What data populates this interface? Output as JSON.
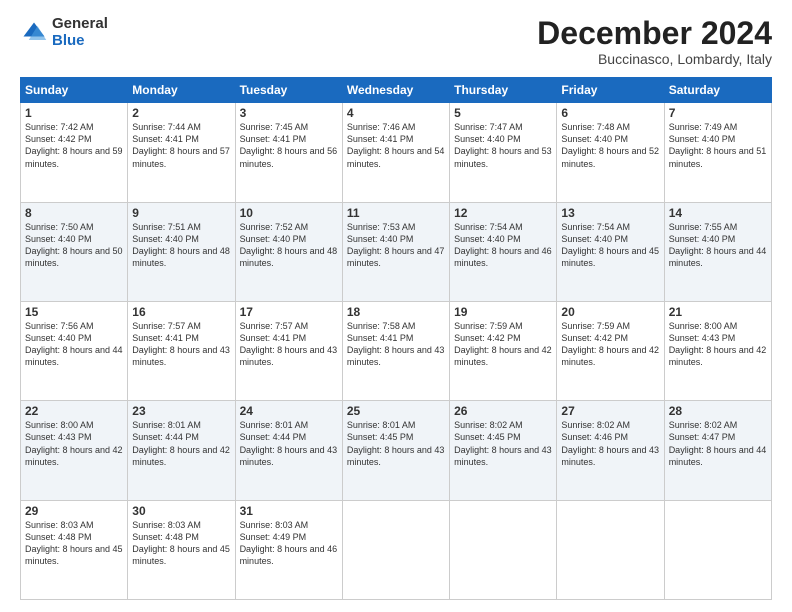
{
  "logo": {
    "general": "General",
    "blue": "Blue"
  },
  "title": "December 2024",
  "location": "Buccinasco, Lombardy, Italy",
  "headers": [
    "Sunday",
    "Monday",
    "Tuesday",
    "Wednesday",
    "Thursday",
    "Friday",
    "Saturday"
  ],
  "weeks": [
    [
      {
        "day": "1",
        "sunrise": "7:42 AM",
        "sunset": "4:42 PM",
        "daylight": "8 hours and 59 minutes."
      },
      {
        "day": "2",
        "sunrise": "7:44 AM",
        "sunset": "4:41 PM",
        "daylight": "8 hours and 57 minutes."
      },
      {
        "day": "3",
        "sunrise": "7:45 AM",
        "sunset": "4:41 PM",
        "daylight": "8 hours and 56 minutes."
      },
      {
        "day": "4",
        "sunrise": "7:46 AM",
        "sunset": "4:41 PM",
        "daylight": "8 hours and 54 minutes."
      },
      {
        "day": "5",
        "sunrise": "7:47 AM",
        "sunset": "4:40 PM",
        "daylight": "8 hours and 53 minutes."
      },
      {
        "day": "6",
        "sunrise": "7:48 AM",
        "sunset": "4:40 PM",
        "daylight": "8 hours and 52 minutes."
      },
      {
        "day": "7",
        "sunrise": "7:49 AM",
        "sunset": "4:40 PM",
        "daylight": "8 hours and 51 minutes."
      }
    ],
    [
      {
        "day": "8",
        "sunrise": "7:50 AM",
        "sunset": "4:40 PM",
        "daylight": "8 hours and 50 minutes."
      },
      {
        "day": "9",
        "sunrise": "7:51 AM",
        "sunset": "4:40 PM",
        "daylight": "8 hours and 48 minutes."
      },
      {
        "day": "10",
        "sunrise": "7:52 AM",
        "sunset": "4:40 PM",
        "daylight": "8 hours and 48 minutes."
      },
      {
        "day": "11",
        "sunrise": "7:53 AM",
        "sunset": "4:40 PM",
        "daylight": "8 hours and 47 minutes."
      },
      {
        "day": "12",
        "sunrise": "7:54 AM",
        "sunset": "4:40 PM",
        "daylight": "8 hours and 46 minutes."
      },
      {
        "day": "13",
        "sunrise": "7:54 AM",
        "sunset": "4:40 PM",
        "daylight": "8 hours and 45 minutes."
      },
      {
        "day": "14",
        "sunrise": "7:55 AM",
        "sunset": "4:40 PM",
        "daylight": "8 hours and 44 minutes."
      }
    ],
    [
      {
        "day": "15",
        "sunrise": "7:56 AM",
        "sunset": "4:40 PM",
        "daylight": "8 hours and 44 minutes."
      },
      {
        "day": "16",
        "sunrise": "7:57 AM",
        "sunset": "4:41 PM",
        "daylight": "8 hours and 43 minutes."
      },
      {
        "day": "17",
        "sunrise": "7:57 AM",
        "sunset": "4:41 PM",
        "daylight": "8 hours and 43 minutes."
      },
      {
        "day": "18",
        "sunrise": "7:58 AM",
        "sunset": "4:41 PM",
        "daylight": "8 hours and 43 minutes."
      },
      {
        "day": "19",
        "sunrise": "7:59 AM",
        "sunset": "4:42 PM",
        "daylight": "8 hours and 42 minutes."
      },
      {
        "day": "20",
        "sunrise": "7:59 AM",
        "sunset": "4:42 PM",
        "daylight": "8 hours and 42 minutes."
      },
      {
        "day": "21",
        "sunrise": "8:00 AM",
        "sunset": "4:43 PM",
        "daylight": "8 hours and 42 minutes."
      }
    ],
    [
      {
        "day": "22",
        "sunrise": "8:00 AM",
        "sunset": "4:43 PM",
        "daylight": "8 hours and 42 minutes."
      },
      {
        "day": "23",
        "sunrise": "8:01 AM",
        "sunset": "4:44 PM",
        "daylight": "8 hours and 42 minutes."
      },
      {
        "day": "24",
        "sunrise": "8:01 AM",
        "sunset": "4:44 PM",
        "daylight": "8 hours and 43 minutes."
      },
      {
        "day": "25",
        "sunrise": "8:01 AM",
        "sunset": "4:45 PM",
        "daylight": "8 hours and 43 minutes."
      },
      {
        "day": "26",
        "sunrise": "8:02 AM",
        "sunset": "4:45 PM",
        "daylight": "8 hours and 43 minutes."
      },
      {
        "day": "27",
        "sunrise": "8:02 AM",
        "sunset": "4:46 PM",
        "daylight": "8 hours and 43 minutes."
      },
      {
        "day": "28",
        "sunrise": "8:02 AM",
        "sunset": "4:47 PM",
        "daylight": "8 hours and 44 minutes."
      }
    ],
    [
      {
        "day": "29",
        "sunrise": "8:03 AM",
        "sunset": "4:48 PM",
        "daylight": "8 hours and 45 minutes."
      },
      {
        "day": "30",
        "sunrise": "8:03 AM",
        "sunset": "4:48 PM",
        "daylight": "8 hours and 45 minutes."
      },
      {
        "day": "31",
        "sunrise": "8:03 AM",
        "sunset": "4:49 PM",
        "daylight": "8 hours and 46 minutes."
      },
      null,
      null,
      null,
      null
    ]
  ]
}
